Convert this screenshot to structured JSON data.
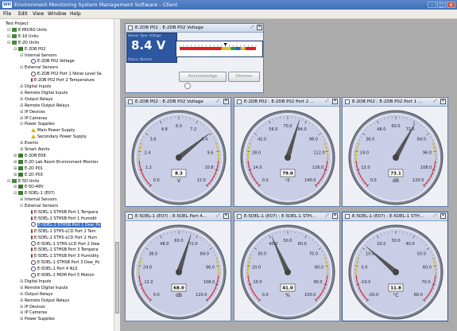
{
  "window": {
    "logo": "WH",
    "title": "Environment Monitoring System Management Software - Client",
    "min": "–",
    "max": "□",
    "close": "✕"
  },
  "menu": [
    "File",
    "Edit",
    "View",
    "Window",
    "Help"
  ],
  "tree": [
    {
      "t": "Test Project",
      "l": 0,
      "tg": "",
      "ic": "none"
    },
    {
      "t": "E-MICRO Units",
      "l": 1,
      "tg": "⊟",
      "ic": "folder"
    },
    {
      "t": "E-16 Units",
      "l": 1,
      "tg": "⊟",
      "ic": "folder"
    },
    {
      "t": "E-2D Units",
      "l": 1,
      "tg": "⊟",
      "ic": "folder"
    },
    {
      "t": "E-2DB P02",
      "l": 2,
      "tg": "⊟",
      "ic": "dev"
    },
    {
      "t": "Internal Sensors",
      "l": 3,
      "tg": "⊟",
      "ic": "none"
    },
    {
      "t": "E-2DB P02 Voltage",
      "l": 4,
      "tg": "",
      "ic": "sensor"
    },
    {
      "t": "External Sensors",
      "l": 3,
      "tg": "⊟",
      "ic": "none"
    },
    {
      "t": "E-2DB P02 Port 1 Noise Level Se",
      "l": 4,
      "tg": "",
      "ic": "sensor"
    },
    {
      "t": "E-2DB P02 Port 2 Temperature",
      "l": 4,
      "tg": "",
      "ic": "temp"
    },
    {
      "t": "Digital Inputs",
      "l": 3,
      "tg": "⊞",
      "ic": "none"
    },
    {
      "t": "Remote Digital Inputs",
      "l": 3,
      "tg": "⊞",
      "ic": "none"
    },
    {
      "t": "Output Relays",
      "l": 3,
      "tg": "⊞",
      "ic": "none"
    },
    {
      "t": "Remote Output Relays",
      "l": 3,
      "tg": "⊞",
      "ic": "none"
    },
    {
      "t": "IP Devices",
      "l": 3,
      "tg": "⊞",
      "ic": "none"
    },
    {
      "t": "IP Cameras",
      "l": 3,
      "tg": "⊞",
      "ic": "none"
    },
    {
      "t": "Power Supplies",
      "l": 3,
      "tg": "⊟",
      "ic": "none"
    },
    {
      "t": "Main Power Supply",
      "l": 4,
      "tg": "",
      "ic": "warn"
    },
    {
      "t": "Secondary Power Supply",
      "l": 4,
      "tg": "",
      "ic": "warn"
    },
    {
      "t": "Events",
      "l": 3,
      "tg": "⊞",
      "ic": "none"
    },
    {
      "t": "Smart Alerts",
      "l": 3,
      "tg": "⊞",
      "ic": "none"
    },
    {
      "t": "E-2DB E08",
      "l": 2,
      "tg": "⊞",
      "ic": "dev"
    },
    {
      "t": "E-2D Lab Room Environment Monitor",
      "l": 2,
      "tg": "⊞",
      "ic": "dev"
    },
    {
      "t": "E-2D P01",
      "l": 2,
      "tg": "⊞",
      "ic": "dev"
    },
    {
      "t": "E-2D P03",
      "l": 2,
      "tg": "⊞",
      "ic": "dev"
    },
    {
      "t": "E-5D Units",
      "l": 1,
      "tg": "⊟",
      "ic": "folder"
    },
    {
      "t": "E-5D-48V",
      "l": 2,
      "tg": "⊞",
      "ic": "dev"
    },
    {
      "t": "E-5DEL-1 (E07)",
      "l": 2,
      "tg": "⊟",
      "ic": "dev"
    },
    {
      "t": "Internal Sensors",
      "l": 3,
      "tg": "⊞",
      "ic": "none"
    },
    {
      "t": "External Sensors",
      "l": 3,
      "tg": "⊟",
      "ic": "none"
    },
    {
      "t": "E-5DEL-1 STHSB Port 1 Tempera",
      "l": 4,
      "tg": "",
      "ic": "temp"
    },
    {
      "t": "E-5DEL-1 STHSB Port 1 Humidit",
      "l": 4,
      "tg": "",
      "ic": "temp"
    },
    {
      "t": "E-5DEL-1 STHSB Port 1 Dew_Po",
      "l": 4,
      "tg": "",
      "ic": "sensor",
      "sel": true
    },
    {
      "t": "E-5DEL-1 STHS-LCD Port 2 Tem",
      "l": 4,
      "tg": "",
      "ic": "temp"
    },
    {
      "t": "E-5DEL-1 STHS-LCD Port 2 Hum",
      "l": 4,
      "tg": "",
      "ic": "temp"
    },
    {
      "t": "E-5DEL-1 STHS-LCD Port 2 Dew",
      "l": 4,
      "tg": "",
      "ic": "sensor"
    },
    {
      "t": "E-5DEL-1 STHSB Port 3 Tempera",
      "l": 4,
      "tg": "",
      "ic": "temp"
    },
    {
      "t": "E-5DEL-1 STHSB Port 3 Humidity",
      "l": 4,
      "tg": "",
      "ic": "temp"
    },
    {
      "t": "E-5DEL-1 STHSB Port 3 Dew_Po",
      "l": 4,
      "tg": "",
      "ic": "sensor"
    },
    {
      "t": "E-5DEL-1 Port 4 NLS",
      "l": 4,
      "tg": "",
      "ic": "sensor"
    },
    {
      "t": "E-5DEL-1 MDM Port 5 Motion",
      "l": 4,
      "tg": "",
      "ic": "sensor"
    },
    {
      "t": "Digital Inputs",
      "l": 3,
      "tg": "⊞",
      "ic": "none"
    },
    {
      "t": "Remote Digital Inputs",
      "l": 3,
      "tg": "⊞",
      "ic": "none"
    },
    {
      "t": "Output Relays",
      "l": 3,
      "tg": "⊞",
      "ic": "none"
    },
    {
      "t": "Remote Output Relays",
      "l": 3,
      "tg": "⊞",
      "ic": "none"
    },
    {
      "t": "IP Devices",
      "l": 3,
      "tg": "⊞",
      "ic": "none"
    },
    {
      "t": "IP Cameras",
      "l": 3,
      "tg": "⊞",
      "ic": "none"
    },
    {
      "t": "Power Supplies",
      "l": 3,
      "tg": "⊞",
      "ic": "none"
    }
  ],
  "voltage_panel": {
    "title": "E-2DB P02 : E-2DB P02 Voltage",
    "header": "Sensor Type: Voltage",
    "value": "8.4 V",
    "status": "Status: Normal",
    "acknowledge": "Acknowledge",
    "dismiss": "Dismiss",
    "level": 0.6
  },
  "gauges": [
    {
      "title": "E-2DB P02 : E-2DB P02 Voltage",
      "unit": "V",
      "value": 8.3,
      "display": "8.3",
      "min": 0,
      "max": 12,
      "ticks": [
        "0.0",
        "1.2",
        "2.4",
        "3.6",
        "4.8",
        "6.0",
        "7.2",
        "8.4",
        "9.6",
        "10.8",
        "12.0"
      ]
    },
    {
      "title": "E-2DB P02 : E-2DB P02 Port 2 ...",
      "unit": "°F",
      "value": 79.0,
      "display": "79.0",
      "min": 0,
      "max": 140,
      "ticks": [
        "0.0",
        "14.0",
        "28.0",
        "42.0",
        "56.0",
        "70.0",
        "84.0",
        "98.0",
        "112.0",
        "126.0",
        "140.0"
      ]
    },
    {
      "title": "E-2DB P02 : E-2DB P02 Port 1 ...",
      "unit": "dB",
      "value": 73.1,
      "display": "73.1",
      "min": 0,
      "max": 120,
      "ticks": [
        "0.0",
        "12.0",
        "24.0",
        "36.0",
        "48.0",
        "60.0",
        "72.0",
        "84.0",
        "96.0",
        "108.0",
        "120.0"
      ]
    },
    {
      "title": "E-5DEL-1 (E07) : E-5DEL Port 4...",
      "unit": "dB",
      "value": 68.0,
      "display": "68.0",
      "min": 0,
      "max": 120,
      "ticks": [
        "0.0",
        "12.0",
        "24.0",
        "36.0",
        "48.0",
        "60.0",
        "72.0",
        "84.0",
        "96.0",
        "108.0",
        "120.0"
      ]
    },
    {
      "title": "E-5DEL-1 (E07) : E-5DEL-1 STH...",
      "unit": "%",
      "value": 41.0,
      "display": "41.0",
      "min": 0,
      "max": 100,
      "ticks": [
        "0.0",
        "10.0",
        "20.0",
        "30.0",
        "40.0",
        "50.0",
        "60.0",
        "70.0",
        "80.0",
        "90.0",
        "100.0"
      ]
    },
    {
      "title": "E-5DEL-1 (E07) : E-5DEL-1 STH...",
      "unit": "°C",
      "value": 11.8,
      "display": "11.8",
      "min": -20,
      "max": 80,
      "ticks": [
        "-20.0",
        "-10.0",
        "0.0",
        "10.0",
        "20.0",
        "30.0",
        "40.0",
        "50.0",
        "60.0",
        "70.0",
        "80.0"
      ]
    }
  ],
  "colors": {
    "gauge_face": "#c9cde6",
    "red": "#e03030",
    "yellow": "#e0c020",
    "green": "#28a040",
    "panel_blue": "#2d57a0"
  }
}
